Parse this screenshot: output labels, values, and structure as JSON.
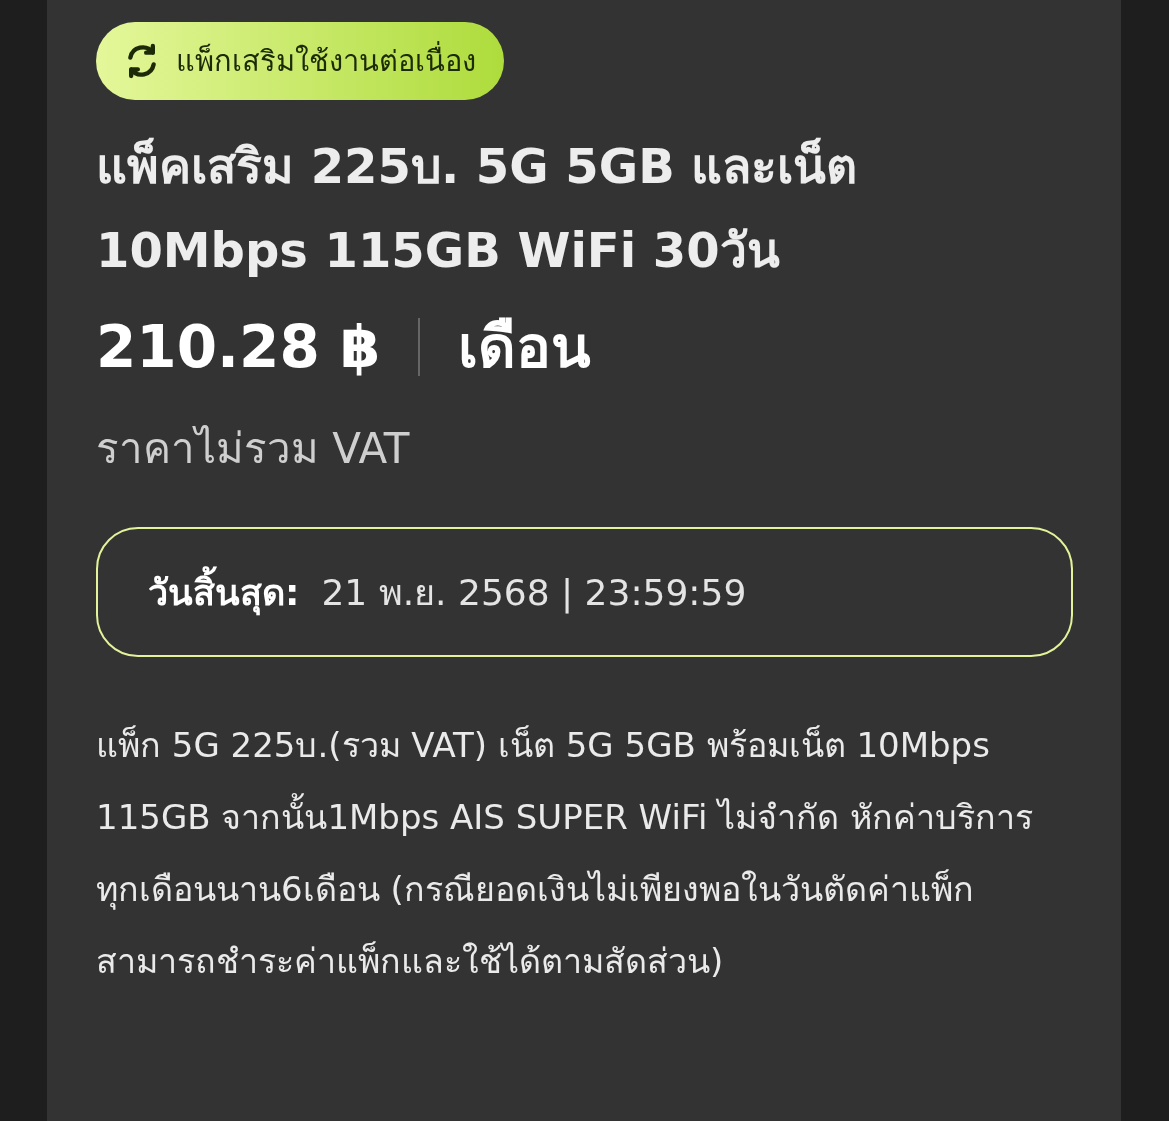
{
  "badge": {
    "label": "แพ็กเสริมใช้งานต่อเนื่อง"
  },
  "title": "แพ็คเสริม 225บ. 5G 5GB และเน็ต 10Mbps 115GB WiFi 30วัน",
  "price": {
    "amount": "210.28 ฿",
    "period": "เดือน"
  },
  "vat_note": "ราคาไม่รวม VAT",
  "expiry": {
    "label": "วันสิ้นสุด:",
    "value": "21 พ.ย. 2568 | 23:59:59"
  },
  "description": "แพ็ก 5G 225บ.(รวม VAT) เน็ต 5G 5GB พร้อมเน็ต 10Mbps 115GB จากนั้น1Mbps AIS SUPER WiFi ไม่จำกัด หักค่าบริการทุกเดือนนาน6เดือน (กรณียอดเงินไม่เพียงพอในวันตัดค่าแพ็ก สามารถชำระค่าแพ็กและใช้ได้ตามสัดส่วน)"
}
